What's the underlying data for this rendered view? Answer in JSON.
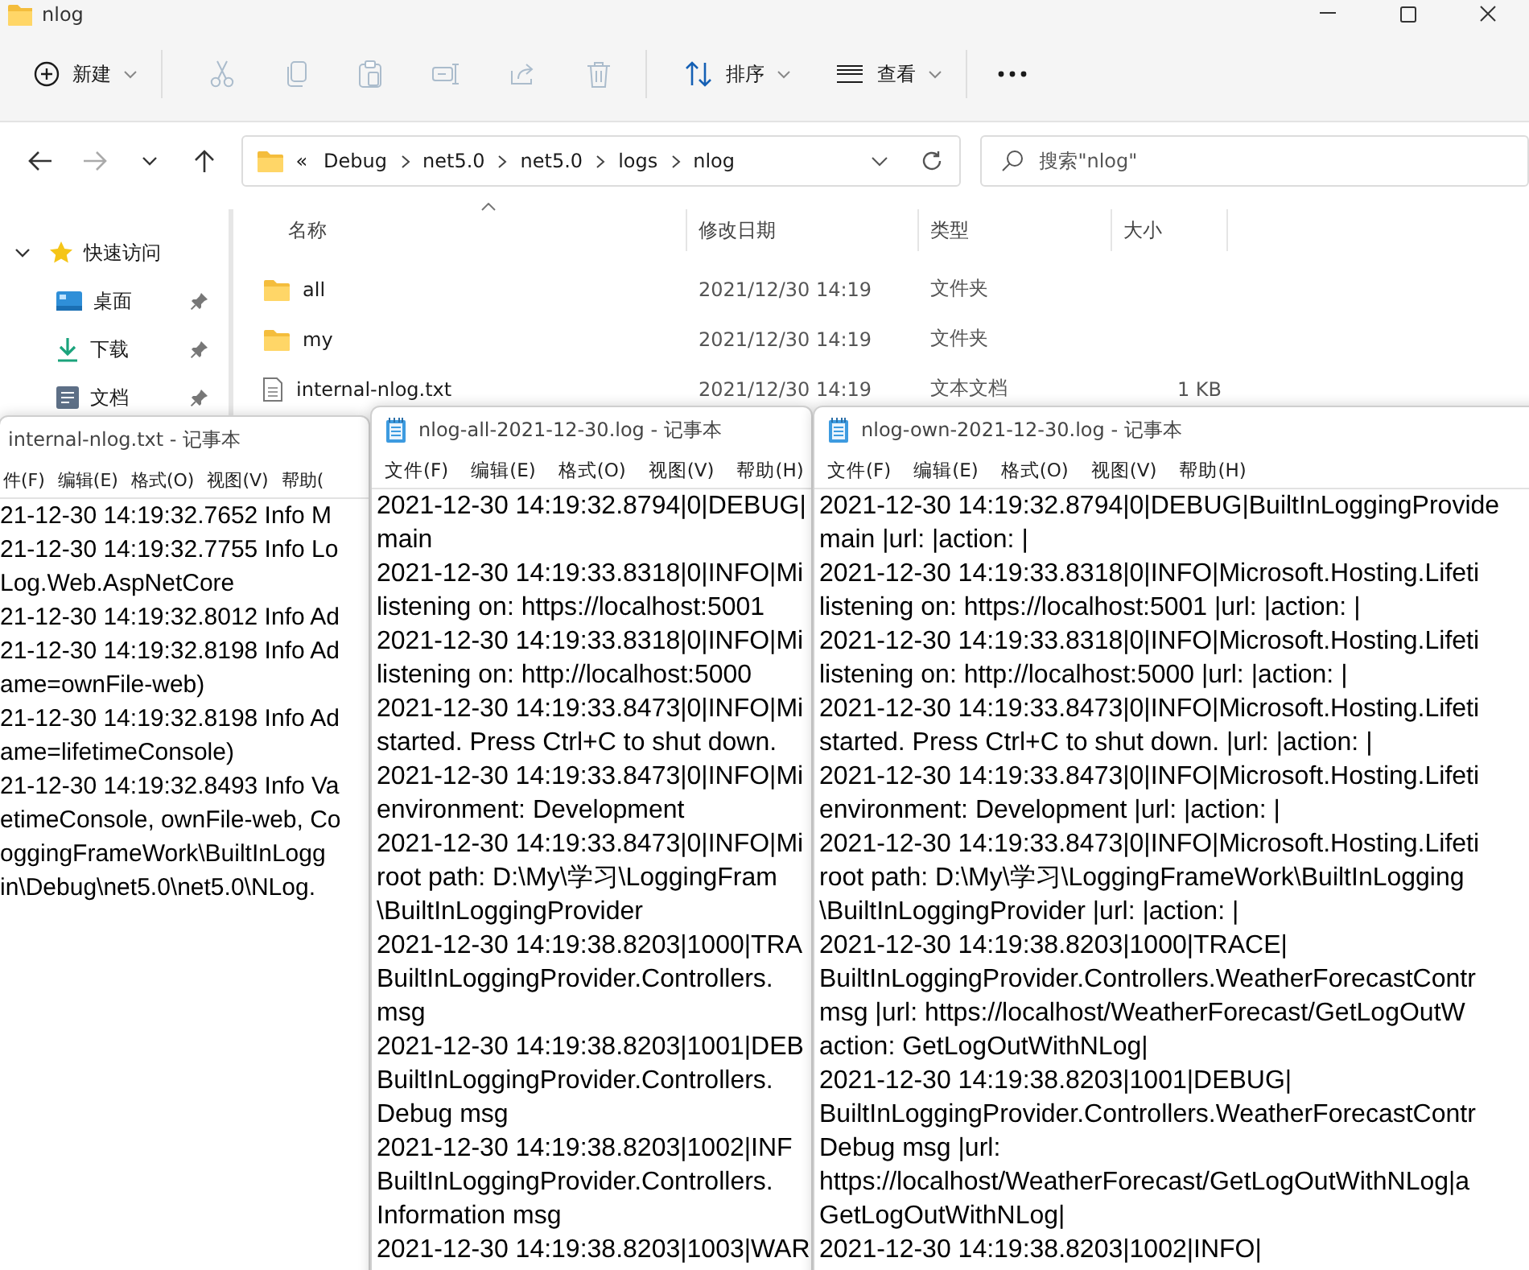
{
  "explorer": {
    "title": "nlog",
    "toolbar": [
      {
        "kind": "new",
        "label": "新建",
        "disabled": false
      },
      {
        "kind": "cut",
        "disabled": true
      },
      {
        "kind": "copy",
        "disabled": true
      },
      {
        "kind": "paste",
        "disabled": true
      },
      {
        "kind": "rename",
        "disabled": true
      },
      {
        "kind": "share",
        "disabled": true
      },
      {
        "kind": "delete",
        "disabled": true
      },
      {
        "kind": "sort",
        "label": "排序",
        "disabled": false
      },
      {
        "kind": "view",
        "label": "查看",
        "disabled": false
      },
      {
        "kind": "more",
        "disabled": false
      }
    ],
    "navigation": [
      {
        "kind": "back",
        "disabled": false
      },
      {
        "kind": "forward",
        "disabled": true
      },
      {
        "kind": "recent",
        "disabled": false
      },
      {
        "kind": "up",
        "disabled": false
      }
    ],
    "address_bar": {
      "overflow": "«",
      "segments": [
        "Debug",
        "net5.0",
        "net5.0",
        "logs",
        "nlog"
      ]
    },
    "search": {
      "placeholder": "搜索\"nlog\""
    },
    "sidebar": {
      "items": [
        {
          "kind": "quick",
          "label": "快速访问",
          "expanded": true,
          "children": [
            {
              "kind": "desktop",
              "label": "桌面",
              "pinned": true
            },
            {
              "kind": "downloads",
              "label": "下载",
              "pinned": true
            },
            {
              "kind": "documents",
              "label": "文档",
              "pinned": true
            }
          ]
        }
      ]
    },
    "table": {
      "columns": [
        {
          "label": "名称",
          "sorted": true
        },
        {
          "label": "修改日期",
          "sorted": false
        },
        {
          "label": "类型",
          "sorted": false
        },
        {
          "label": "大小",
          "sorted": false
        }
      ],
      "rows": [
        {
          "kind": "folder",
          "name": "all",
          "modified": "2021/12/30 14:19",
          "type": "文件夹"
        },
        {
          "kind": "folder",
          "name": "my",
          "modified": "2021/12/30 14:19",
          "type": "文件夹"
        },
        {
          "kind": "file",
          "name": "internal-nlog.txt",
          "modified": "2021/12/30 14:19",
          "type": "文本文档",
          "size": "1 KB"
        }
      ]
    }
  },
  "notepad_windows": [
    {
      "title": "internal-nlog.txt - 记事本",
      "menu": [
        "件(F)",
        "编辑(E)",
        "格式(O)",
        "视图(V)",
        "帮助("
      ],
      "lines": [
        "21-12-30 14:19:32.7652 Info M",
        "21-12-30 14:19:32.7755 Info Lo",
        "Log.Web.AspNetCore",
        "21-12-30 14:19:32.8012 Info Ad",
        "21-12-30 14:19:32.8198 Info Ad",
        "ame=ownFile-web)",
        "21-12-30 14:19:32.8198 Info Ad",
        "ame=lifetimeConsole)",
        "21-12-30 14:19:32.8493 Info Va",
        "etimeConsole, ownFile-web, Co",
        "oggingFrameWork\\BuiltInLogg",
        "in\\Debug\\net5.0\\net5.0\\NLog."
      ]
    },
    {
      "title": "nlog-all-2021-12-30.log - 记事本",
      "menu": [
        "文件(F)",
        "编辑(E)",
        "格式(O)",
        "视图(V)",
        "帮助(H)"
      ],
      "lines": [
        "2021-12-30 14:19:32.8794|0|DEBUG|",
        "main",
        "2021-12-30 14:19:33.8318|0|INFO|Mi",
        "listening on: https://localhost:5001",
        "2021-12-30 14:19:33.8318|0|INFO|Mi",
        "listening on: http://localhost:5000",
        "2021-12-30 14:19:33.8473|0|INFO|Mi",
        "started. Press Ctrl+C to shut down.",
        "2021-12-30 14:19:33.8473|0|INFO|Mi",
        "environment: Development",
        "2021-12-30 14:19:33.8473|0|INFO|Mi",
        "root path: D:\\My\\学习\\LoggingFram",
        "\\BuiltInLoggingProvider",
        "2021-12-30 14:19:38.8203|1000|TRA",
        "BuiltInLoggingProvider.Controllers.",
        "msg",
        "2021-12-30 14:19:38.8203|1001|DEB",
        "BuiltInLoggingProvider.Controllers.",
        "Debug msg",
        "2021-12-30 14:19:38.8203|1002|INF",
        "BuiltInLoggingProvider.Controllers.",
        "Information msg",
        "2021-12-30 14:19:38.8203|1003|WAR"
      ]
    },
    {
      "title": "nlog-own-2021-12-30.log - 记事本",
      "menu": [
        "文件(F)",
        "编辑(E)",
        "格式(O)",
        "视图(V)",
        "帮助(H)"
      ],
      "lines": [
        "2021-12-30 14:19:32.8794|0|DEBUG|BuiltInLoggingProvide",
        "main |url: |action: |",
        "2021-12-30 14:19:33.8318|0|INFO|Microsoft.Hosting.Lifeti",
        "listening on: https://localhost:5001 |url: |action: |",
        "2021-12-30 14:19:33.8318|0|INFO|Microsoft.Hosting.Lifeti",
        "listening on: http://localhost:5000 |url: |action: |",
        "2021-12-30 14:19:33.8473|0|INFO|Microsoft.Hosting.Lifeti",
        "started. Press Ctrl+C to shut down. |url: |action: |",
        "2021-12-30 14:19:33.8473|0|INFO|Microsoft.Hosting.Lifeti",
        "environment: Development |url: |action: |",
        "2021-12-30 14:19:33.8473|0|INFO|Microsoft.Hosting.Lifeti",
        "root path: D:\\My\\学习\\LoggingFrameWork\\BuiltInLogging",
        "\\BuiltInLoggingProvider |url: |action: |",
        "2021-12-30 14:19:38.8203|1000|TRACE|",
        "BuiltInLoggingProvider.Controllers.WeatherForecastContr",
        "msg |url: https://localhost/WeatherForecast/GetLogOutW",
        "action: GetLogOutWithNLog|",
        "2021-12-30 14:19:38.8203|1001|DEBUG|",
        "BuiltInLoggingProvider.Controllers.WeatherForecastContr",
        "Debug msg |url:",
        "https://localhost/WeatherForecast/GetLogOutWithNLog|a",
        "GetLogOutWithNLog|",
        "2021-12-30 14:19:38.8203|1002|INFO|"
      ]
    }
  ]
}
